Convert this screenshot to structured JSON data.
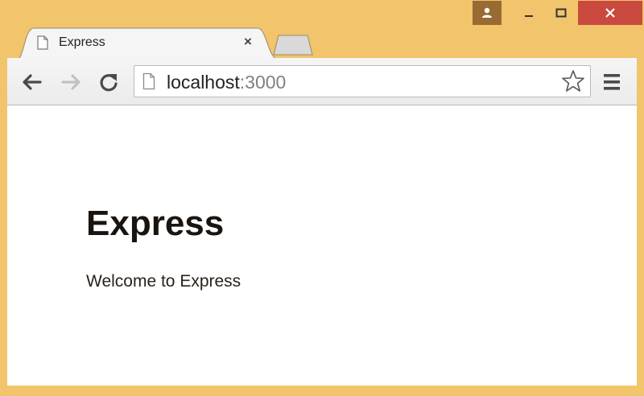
{
  "tab": {
    "title": "Express",
    "close_label": "×"
  },
  "omnibox": {
    "host": "localhost",
    "port": ":3000"
  },
  "page": {
    "heading": "Express",
    "paragraph": "Welcome to Express"
  }
}
